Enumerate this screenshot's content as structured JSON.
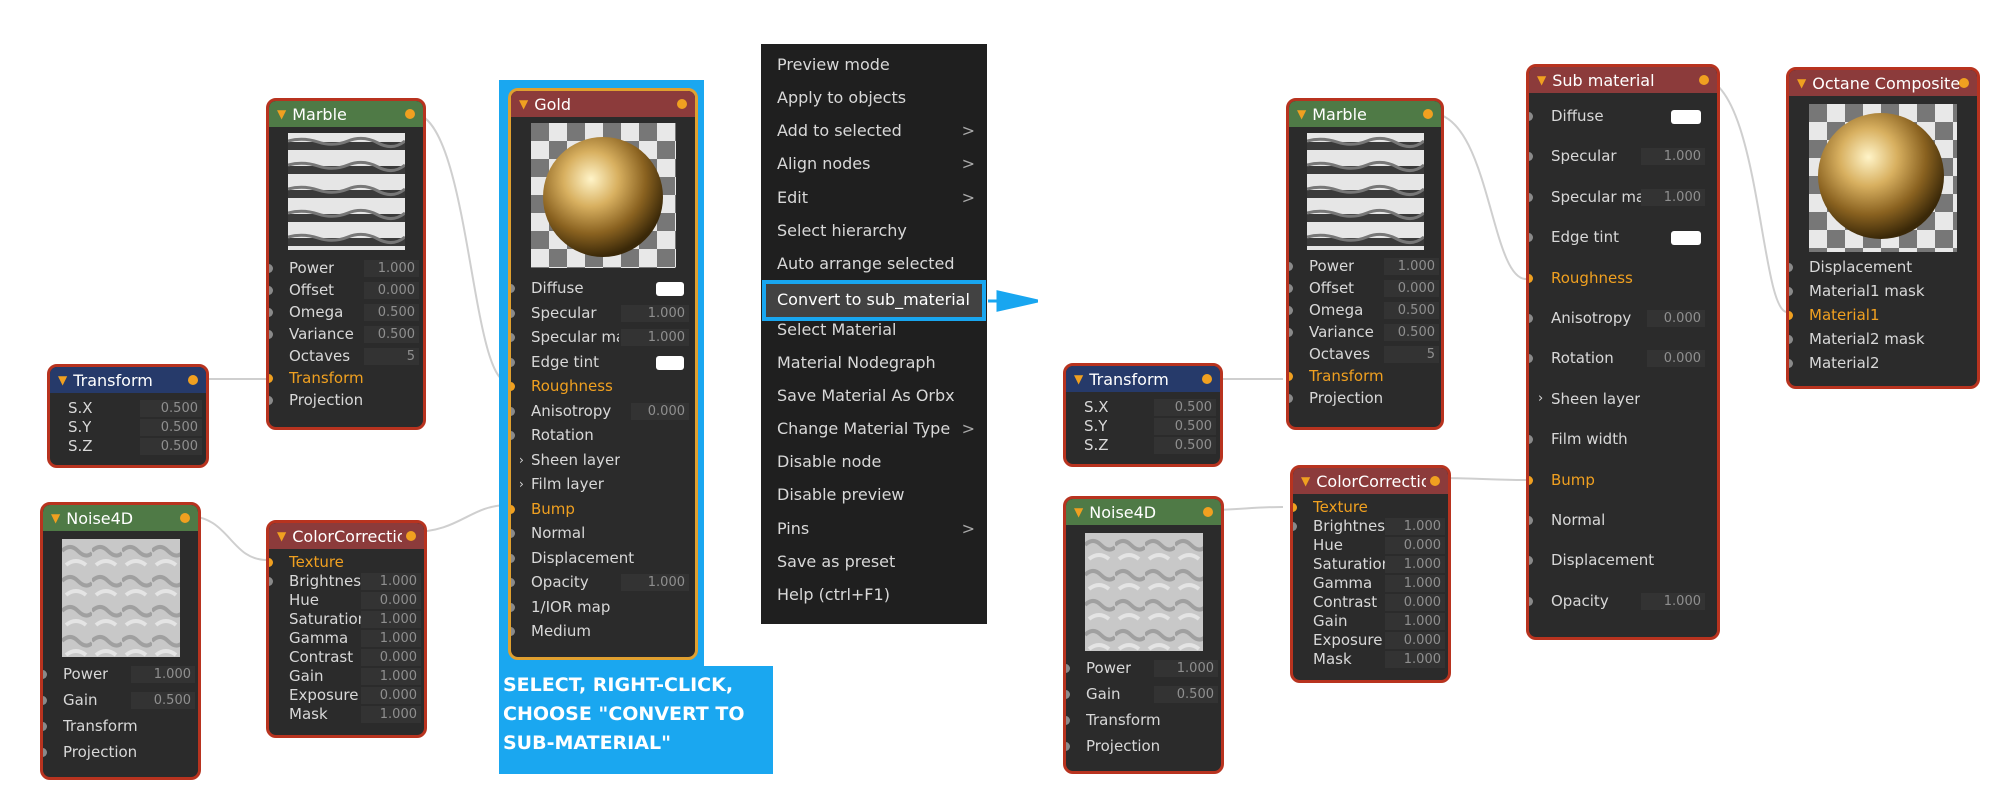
{
  "colors": {
    "accent": "#1aa7f0",
    "node_border": "#b8331f",
    "selected_border": "#e0a030",
    "pin_orange": "#f0a020"
  },
  "left": {
    "marble": {
      "title": "Marble",
      "rows": [
        {
          "label": "Power",
          "value": "1.000"
        },
        {
          "label": "Offset",
          "value": "0.000"
        },
        {
          "label": "Omega",
          "value": "0.500"
        },
        {
          "label": "Variance",
          "value": "0.500"
        },
        {
          "label": "Octaves",
          "value": "5"
        },
        {
          "label": "Transform",
          "value": ""
        },
        {
          "label": "Projection",
          "value": ""
        }
      ]
    },
    "transform": {
      "title": "Transform",
      "rows": [
        {
          "label": "S.X",
          "value": "0.500"
        },
        {
          "label": "S.Y",
          "value": "0.500"
        },
        {
          "label": "S.Z",
          "value": "0.500"
        }
      ]
    },
    "noise": {
      "title": "Noise4D",
      "rows": [
        {
          "label": "Power",
          "value": "1.000"
        },
        {
          "label": "Gain",
          "value": "0.500"
        },
        {
          "label": "Transform",
          "value": ""
        },
        {
          "label": "Projection",
          "value": ""
        }
      ]
    },
    "color": {
      "title": "ColorCorrection",
      "rows": [
        {
          "label": "Texture",
          "value": ""
        },
        {
          "label": "Brightness",
          "value": "1.000"
        },
        {
          "label": "Hue",
          "value": "0.000"
        },
        {
          "label": "Saturation",
          "value": "1.000"
        },
        {
          "label": "Gamma",
          "value": "1.000"
        },
        {
          "label": "Contrast",
          "value": "0.000"
        },
        {
          "label": "Gain",
          "value": "1.000"
        },
        {
          "label": "Exposure",
          "value": "0.000"
        },
        {
          "label": "Mask",
          "value": "1.000"
        }
      ]
    },
    "gold": {
      "title": "Gold",
      "rows": [
        {
          "label": "Diffuse",
          "value": ""
        },
        {
          "label": "Specular",
          "value": "1.000"
        },
        {
          "label": "Specular map",
          "value": "1.000"
        },
        {
          "label": "Edge tint",
          "value": ""
        },
        {
          "label": "Roughness",
          "value": ""
        },
        {
          "label": "Anisotropy",
          "value": "0.000"
        },
        {
          "label": "Rotation",
          "value": ""
        },
        {
          "label": "Sheen layer",
          "value": ""
        },
        {
          "label": "Film layer",
          "value": ""
        },
        {
          "label": "Bump",
          "value": ""
        },
        {
          "label": "Normal",
          "value": ""
        },
        {
          "label": "Displacement",
          "value": ""
        },
        {
          "label": "Opacity",
          "value": "1.000"
        },
        {
          "label": "1/IOR map",
          "value": ""
        },
        {
          "label": "Medium",
          "value": ""
        }
      ]
    }
  },
  "menu": {
    "items": [
      "Preview mode",
      "Apply to objects",
      "Add to selected",
      "Align nodes",
      "Edit",
      "Select hierarchy",
      "Auto arrange selected",
      "Convert to sub_material",
      "Select Material",
      "Material Nodegraph",
      "Save Material As Orbx",
      "Change Material Type",
      "Disable node",
      "Disable preview",
      "Pins",
      "Save as preset",
      "Help (ctrl+F1)"
    ],
    "highlighted": "Convert to sub_material",
    "submenu_chevron": ">"
  },
  "caption": {
    "line1": "SELECT, RIGHT-CLICK,",
    "line2": "CHOOSE \"CONVERT TO",
    "line3": "SUB-MATERIAL\""
  },
  "right": {
    "marble": {
      "title": "Marble",
      "rows": [
        {
          "label": "Power",
          "value": "1.000"
        },
        {
          "label": "Offset",
          "value": "0.000"
        },
        {
          "label": "Omega",
          "value": "0.500"
        },
        {
          "label": "Variance",
          "value": "0.500"
        },
        {
          "label": "Octaves",
          "value": "5"
        },
        {
          "label": "Transform",
          "value": ""
        },
        {
          "label": "Projection",
          "value": ""
        }
      ]
    },
    "transform": {
      "title": "Transform",
      "rows": [
        {
          "label": "S.X",
          "value": "0.500"
        },
        {
          "label": "S.Y",
          "value": "0.500"
        },
        {
          "label": "S.Z",
          "value": "0.500"
        }
      ]
    },
    "noise": {
      "title": "Noise4D",
      "rows": [
        {
          "label": "Power",
          "value": "1.000"
        },
        {
          "label": "Gain",
          "value": "0.500"
        },
        {
          "label": "Transform",
          "value": ""
        },
        {
          "label": "Projection",
          "value": ""
        }
      ]
    },
    "color": {
      "title": "ColorCorrection",
      "rows": [
        {
          "label": "Texture",
          "value": ""
        },
        {
          "label": "Brightness",
          "value": "1.000"
        },
        {
          "label": "Hue",
          "value": "0.000"
        },
        {
          "label": "Saturation",
          "value": "1.000"
        },
        {
          "label": "Gamma",
          "value": "1.000"
        },
        {
          "label": "Contrast",
          "value": "0.000"
        },
        {
          "label": "Gain",
          "value": "1.000"
        },
        {
          "label": "Exposure",
          "value": "0.000"
        },
        {
          "label": "Mask",
          "value": "1.000"
        }
      ]
    },
    "sub": {
      "title": "Sub material",
      "rows": [
        {
          "label": "Diffuse",
          "value": ""
        },
        {
          "label": "Specular",
          "value": "1.000"
        },
        {
          "label": "Specular map",
          "value": "1.000"
        },
        {
          "label": "Edge tint",
          "value": ""
        },
        {
          "label": "Roughness",
          "value": ""
        },
        {
          "label": "Anisotropy",
          "value": "0.000"
        },
        {
          "label": "Rotation",
          "value": "0.000"
        },
        {
          "label": "Sheen layer",
          "value": ""
        },
        {
          "label": "Film width",
          "value": ""
        },
        {
          "label": "Bump",
          "value": ""
        },
        {
          "label": "Normal",
          "value": ""
        },
        {
          "label": "Displacement",
          "value": ""
        },
        {
          "label": "Opacity",
          "value": "1.000"
        }
      ]
    },
    "composite": {
      "title": "Octane Composite",
      "rows": [
        {
          "label": "Displacement"
        },
        {
          "label": "Material1 mask"
        },
        {
          "label": "Material1"
        },
        {
          "label": "Material2 mask"
        },
        {
          "label": "Material2"
        }
      ]
    }
  }
}
